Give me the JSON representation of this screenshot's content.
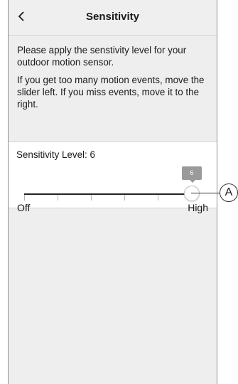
{
  "header": {
    "back_icon": "chevron-left-icon",
    "title": "Sensitivity"
  },
  "intro": {
    "paragraph_1": "Please apply the senstivity level for your outdoor motion sensor.",
    "paragraph_2": "If you get too many motion events, move the slider left. If you miss events, move it to the right."
  },
  "sensitivity": {
    "label": "Sensitivity Level: 6",
    "value": 6,
    "value_tooltip": "6",
    "min_label": "Off",
    "max_label": "High",
    "level_fraction": 1.0
  },
  "annotation": {
    "callout_letter": "A"
  }
}
